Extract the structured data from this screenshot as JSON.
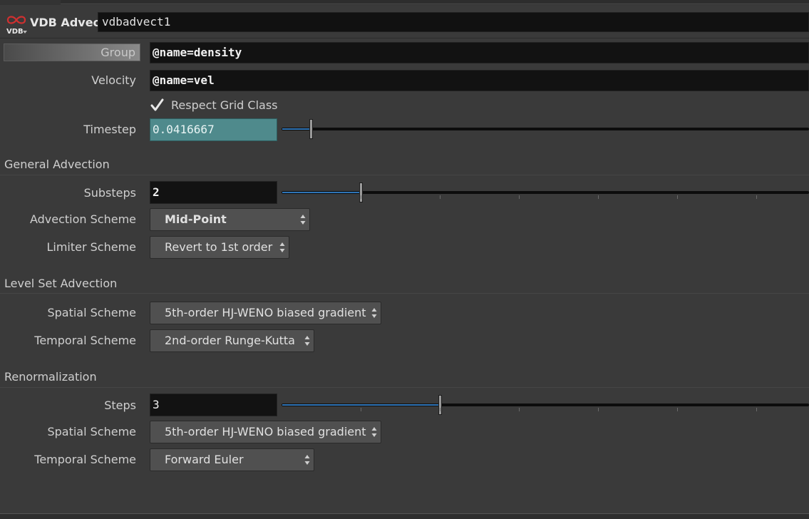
{
  "header": {
    "node_type": "VDB Advect",
    "node_name": "vdbadvect1",
    "logo_text": "VDB"
  },
  "params": {
    "group": {
      "label": "Group",
      "value": "@name=density"
    },
    "velocity": {
      "label": "Velocity",
      "value": "@name=vel"
    },
    "respect_grid_class": {
      "label": "Respect Grid Class",
      "checked": true
    },
    "timestep": {
      "label": "Timestep",
      "value": "0.0416667",
      "slider_fraction": 0.056
    }
  },
  "general_advection": {
    "title": "General Advection",
    "substeps": {
      "label": "Substeps",
      "value": "2",
      "slider_fraction": 0.15
    },
    "advection_scheme": {
      "label": "Advection Scheme",
      "value": "Mid-Point"
    },
    "limiter_scheme": {
      "label": "Limiter Scheme",
      "value": "Revert to 1st order"
    }
  },
  "level_set_advection": {
    "title": "Level Set Advection",
    "spatial_scheme": {
      "label": "Spatial Scheme",
      "value": "5th-order HJ-WENO biased gradient"
    },
    "temporal_scheme": {
      "label": "Temporal Scheme",
      "value": "2nd-order Runge-Kutta"
    }
  },
  "renormalization": {
    "title": "Renormalization",
    "steps": {
      "label": "Steps",
      "value": "3",
      "slider_fraction": 0.3
    },
    "spatial_scheme": {
      "label": "Spatial Scheme",
      "value": "5th-order HJ-WENO biased gradient"
    },
    "temporal_scheme": {
      "label": "Temporal Scheme",
      "value": "Forward Euler"
    }
  },
  "colors": {
    "background": "#3a3a3a",
    "field_bg": "#121212",
    "timestep_highlight": "#4f8a8c",
    "slider_fill": "#2f74b6",
    "dropdown_bg": "#505050",
    "logo_red": "#d03030"
  }
}
